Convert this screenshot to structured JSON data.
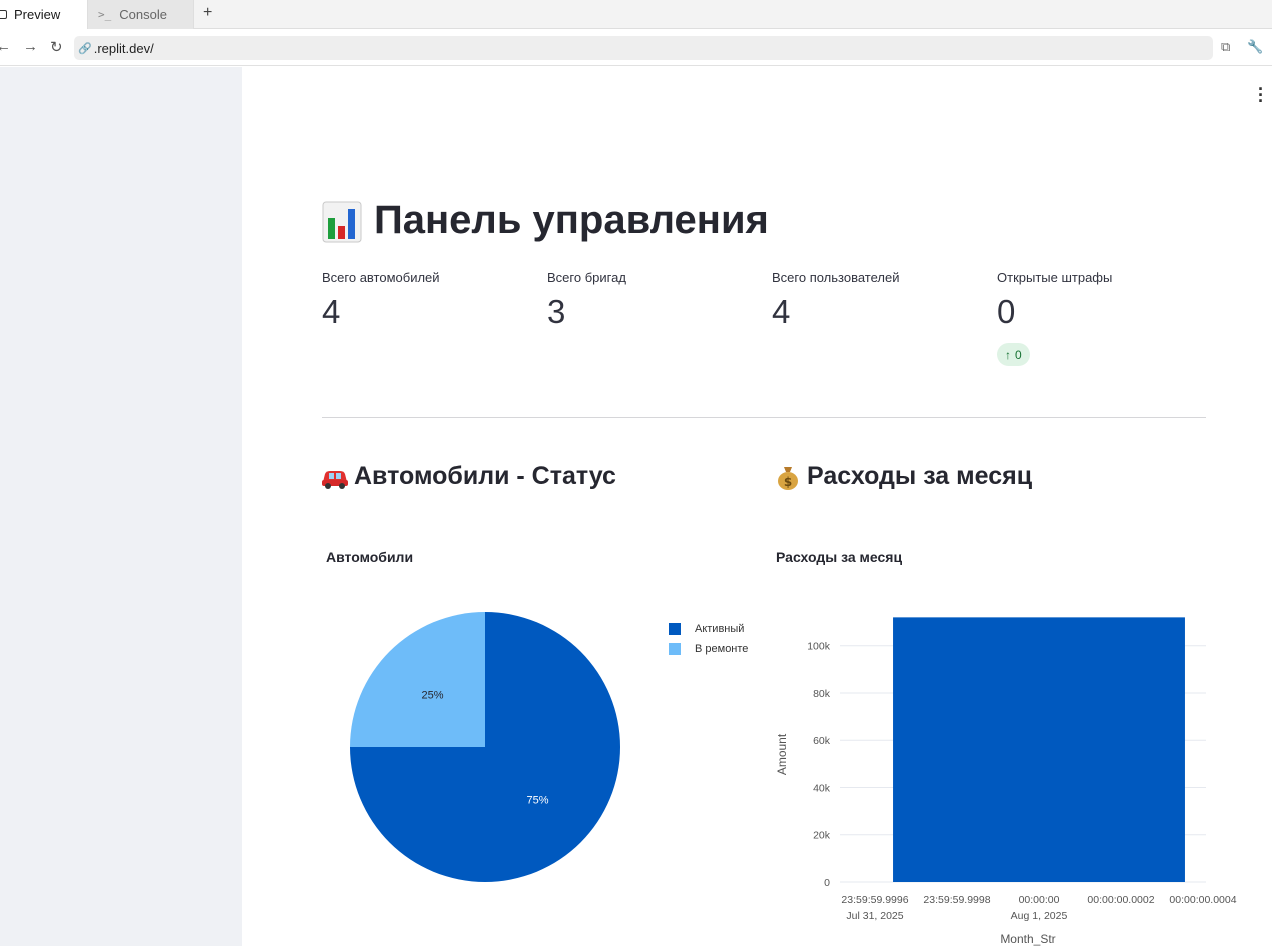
{
  "browser": {
    "tabs": [
      {
        "label": "Preview",
        "active": true
      },
      {
        "label": "Console",
        "active": false
      }
    ],
    "new_tab": "+",
    "url": ".replit.dev/"
  },
  "page": {
    "title": "Панель управления",
    "title_icon": "bar-chart-emoji"
  },
  "metrics": [
    {
      "label": "Всего автомобилей",
      "value": "4"
    },
    {
      "label": "Всего бригад",
      "value": "3"
    },
    {
      "label": "Всего пользователей",
      "value": "4"
    },
    {
      "label": "Открытые штрафы",
      "value": "0",
      "delta": "0",
      "delta_arrow": "↑",
      "delta_color": "#177233"
    }
  ],
  "sections": {
    "cars": {
      "heading": "Автомобили - Статус",
      "icon": "car-emoji"
    },
    "expenses": {
      "heading": "Расходы за месяц",
      "icon": "money-bag-emoji"
    }
  },
  "colors": {
    "primary": "#0059bf",
    "secondary": "#6ebcf9"
  },
  "chart_data": [
    {
      "type": "pie",
      "title": "Автомобили",
      "labels": [
        "Активный",
        "В ремонте"
      ],
      "values": [
        75,
        25
      ],
      "value_labels": [
        "75%",
        "25%"
      ],
      "colors": [
        "#0059bf",
        "#6ebcf9"
      ],
      "legend": "top-right"
    },
    {
      "type": "bar",
      "title": "Расходы за месяц",
      "xlabel": "Month_Str",
      "ylabel": "Amount",
      "x_ticks": [
        {
          "line1": "23:59:59.9996",
          "line2": "Jul 31, 2025"
        },
        {
          "line1": "23:59:59.9998",
          "line2": ""
        },
        {
          "line1": "00:00:00",
          "line2": "Aug 1, 2025"
        },
        {
          "line1": "00:00:00.0002",
          "line2": ""
        },
        {
          "line1": "00:00:00.0004",
          "line2": ""
        }
      ],
      "y_ticks": [
        "0",
        "20k",
        "40k",
        "60k",
        "80k",
        "100k"
      ],
      "y_tick_values": [
        0,
        20000,
        40000,
        60000,
        80000,
        100000
      ],
      "ylim": [
        0,
        113000
      ],
      "bars": [
        {
          "x": "Aug 1, 2025",
          "value": 112000
        }
      ],
      "color": "#0059bf",
      "grid": true
    }
  ]
}
